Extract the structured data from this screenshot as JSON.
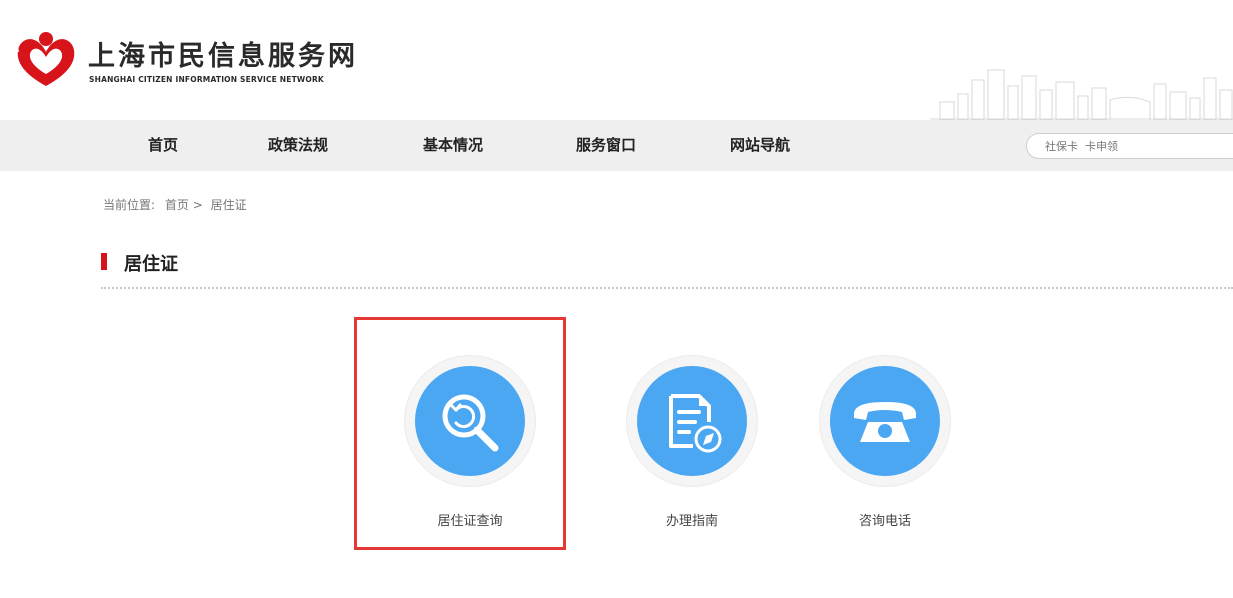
{
  "header": {
    "title": "上海市民信息服务网",
    "subtitle": "SHANGHAI CITIZEN INFORMATION SERVICE NETWORK"
  },
  "nav": {
    "items": [
      "首页",
      "政策法规",
      "基本情况",
      "服务窗口",
      "网站导航"
    ]
  },
  "search": {
    "placeholder": "社保卡  卡申领"
  },
  "breadcrumb": {
    "prefix": "当前位置:",
    "home": "首页",
    "separator": ">",
    "current": "居住证"
  },
  "section": {
    "title": "居住证"
  },
  "services": [
    {
      "label": "居住证查询",
      "icon": "search-refresh-icon"
    },
    {
      "label": "办理指南",
      "icon": "document-compass-icon"
    },
    {
      "label": "咨询电话",
      "icon": "telephone-icon"
    }
  ],
  "colors": {
    "accent_red": "#d7141a",
    "service_blue": "#4ca7f2",
    "highlight_red": "#e53935",
    "nav_bg": "#efefef"
  }
}
